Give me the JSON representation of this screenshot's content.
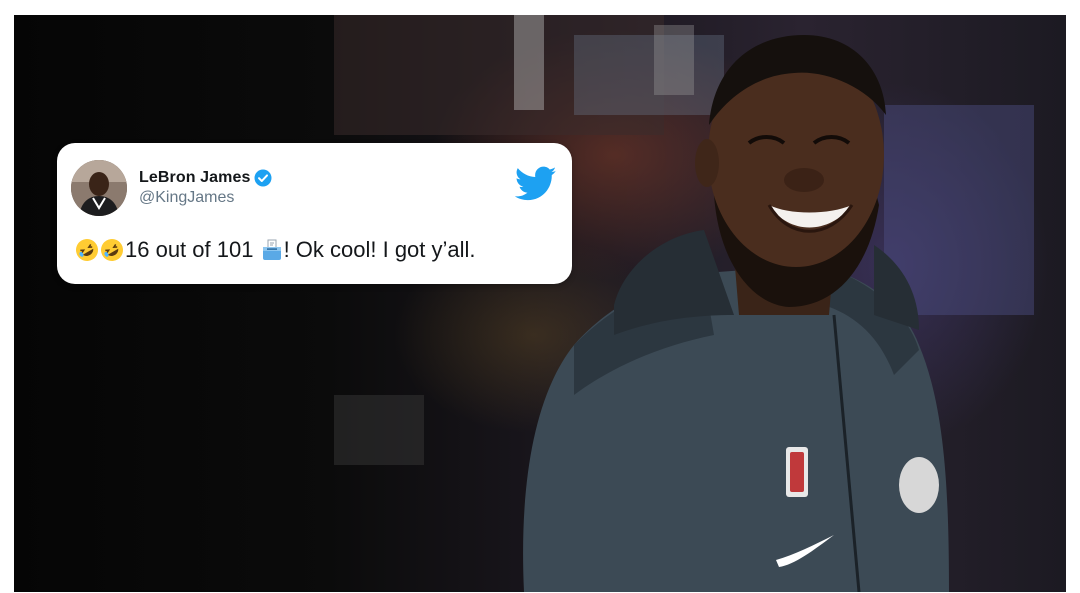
{
  "tweet": {
    "display_name": "LeBron James",
    "handle": "@KingJames",
    "text_part1": "16 out of 101 ",
    "text_part2": "! Ok cool! I got y’all.",
    "emoji_1": "rolling-on-floor-laughing",
    "emoji_2": "rolling-on-floor-laughing",
    "emoji_3": "voting-box",
    "verified_badge": "verified-badge-icon",
    "platform_logo": "twitter-bird-icon"
  },
  "colors": {
    "twitter_blue": "#1DA1F2",
    "name_color": "#14171a",
    "handle_color": "#657786"
  }
}
